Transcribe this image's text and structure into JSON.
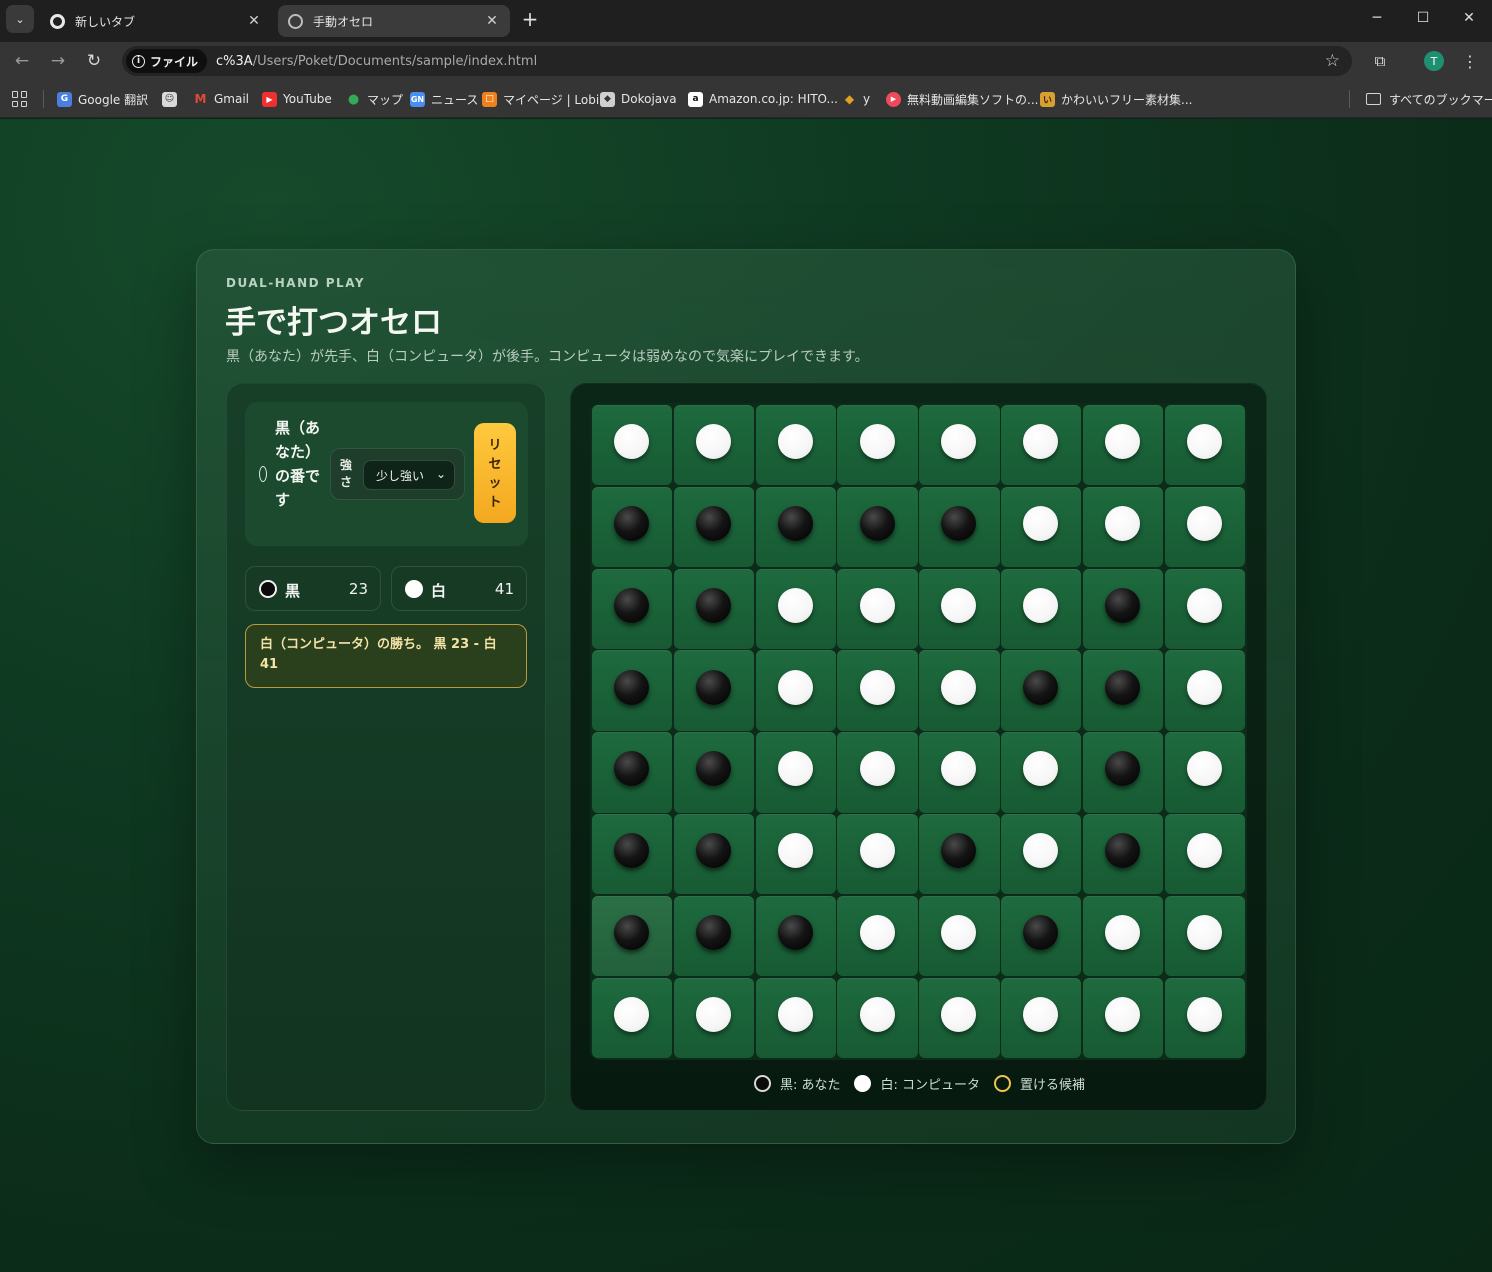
{
  "browser": {
    "tabs": [
      {
        "label": "新しいタブ",
        "active": false
      },
      {
        "label": "手動オセロ",
        "active": true
      }
    ],
    "new_tab": "+",
    "window_controls": {
      "minimize": "─",
      "maximize": "☐",
      "close": "✕"
    },
    "site_chip": "ファイル",
    "url_host": "c%3A",
    "url_path": "/Users/Poket/Documents/sample/index.html",
    "avatar_letter": "T",
    "bookmarks": [
      {
        "label": "Google 翻訳",
        "icon": "google-translate-icon",
        "color": "#4a7fe0"
      },
      {
        "label": "",
        "icon": "face-icon",
        "color": "#d9d9d9"
      },
      {
        "label": "Gmail",
        "icon": "gmail-icon",
        "color": "#e04a3a"
      },
      {
        "label": "YouTube",
        "icon": "youtube-icon",
        "color": "#f03030"
      },
      {
        "label": "マップ",
        "icon": "maps-icon",
        "color": "#34a853"
      },
      {
        "label": "ニュース",
        "icon": "news-icon",
        "color": "#4a8ef0"
      },
      {
        "label": "マイページ | Lobi",
        "icon": "lobi-icon",
        "color": "#f0801e"
      },
      {
        "label": "Dokojava",
        "icon": "dokojava-icon",
        "color": "#cfcfcf"
      },
      {
        "label": "Amazon.co.jp: HITO...",
        "icon": "amazon-icon",
        "color": "#ffffff"
      },
      {
        "label": "y",
        "icon": "diamond-icon",
        "color": "#e0a020"
      },
      {
        "label": "無料動画編集ソフトの...",
        "icon": "video-editor-icon",
        "color": "#f04a5a"
      },
      {
        "label": "かわいいフリー素材集...",
        "icon": "irasutoya-icon",
        "color": "#d9a030"
      }
    ],
    "all_bookmarks": "すべてのブックマーク"
  },
  "header": {
    "eyebrow": "DUAL-HAND PLAY",
    "title": "手で打つオセロ",
    "subtitle": "黒（あなた）が先手、白（コンピュータ）が後手。コンピュータは弱めなので気楽にプレイできます。"
  },
  "controls": {
    "turn_text": "黒（あなた）の番です",
    "level_label": "強さ",
    "level_value": "少し強い",
    "reset_label": "リセット"
  },
  "scores": {
    "black": {
      "name": "黒",
      "count": "23"
    },
    "white": {
      "name": "白",
      "count": "41"
    }
  },
  "result": "白（コンピュータ）の勝ち。 黒 23 - 白 41",
  "board": [
    "WWWWWWWW",
    "BBBBBWWW",
    "BBWWWWBW",
    "BBWWWBBW",
    "BBWWWWBW",
    "BBWWBWBW",
    "BBBWWBWW",
    "WWWWWWWW"
  ],
  "highlighted_cell": [
    6,
    0
  ],
  "legend": {
    "black": "黒: あなた",
    "white": "白: コンピュータ",
    "candidate": "置ける候補"
  },
  "colors": {
    "accent": "#f3a81f",
    "result_border": "#b89b3e",
    "candidate_ring": "#f0c34a",
    "board_cell": "#1e6a3e"
  }
}
